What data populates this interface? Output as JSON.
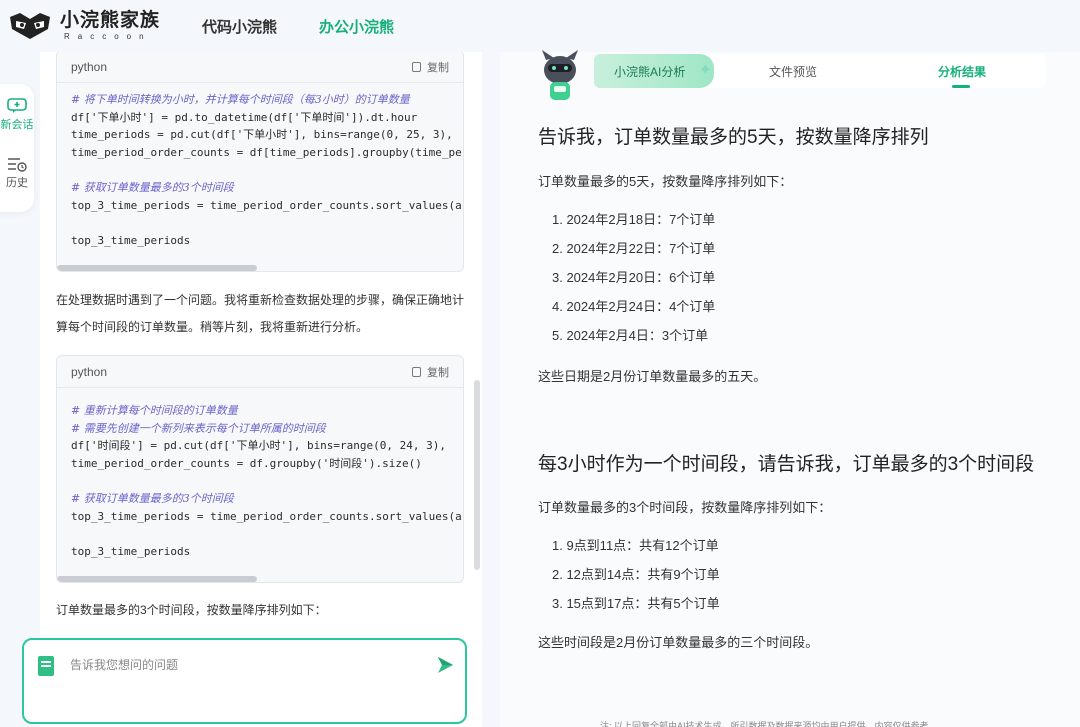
{
  "header": {
    "logo_title": "小浣熊家族",
    "logo_sub": "Raccoon",
    "tabs": [
      {
        "label": "代码小浣熊"
      },
      {
        "label": "办公小浣熊"
      }
    ]
  },
  "siderail": {
    "new_label": "新会话",
    "history_label": "历史"
  },
  "chat": {
    "code_block_1": {
      "lang": "python",
      "copy_label": "复制",
      "lines": [
        "# 将下单时间转换为小时，并计算每个时间段（每3小时）的订单数量",
        "df['下单小时'] = pd.to_datetime(df['下单时间']).dt.hour",
        "time_periods = pd.cut(df['下单小时'], bins=range(0, 25, 3),",
        "time_period_order_counts = df[time_periods].groupby(time_pe",
        "",
        "# 获取订单数量最多的3个时间段",
        "top_3_time_periods = time_period_order_counts.sort_values(a",
        "",
        "top_3_time_periods"
      ]
    },
    "message_1": "在处理数据时遇到了一个问题。我将重新检查数据处理的步骤，确保正确地计算每个时间段的订单数量。稍等片刻，我将重新进行分析。",
    "code_block_2": {
      "lang": "python",
      "copy_label": "复制",
      "lines": [
        "# 重新计算每个时间段的订单数量",
        "# 需要先创建一个新列来表示每个订单所属的时间段",
        "df['时间段'] = pd.cut(df['下单小时'], bins=range(0, 24, 3),",
        "time_period_order_counts = df.groupby('时间段').size()",
        "",
        "# 获取订单数量最多的3个时间段",
        "top_3_time_periods = time_period_order_counts.sort_values(a",
        "",
        "top_3_time_periods"
      ]
    },
    "message_2": "订单数量最多的3个时间段，按数量降序排列如下：",
    "input_placeholder": "告诉我您想问的问题"
  },
  "right": {
    "tab_ai": "小浣熊AI分析",
    "tab_file": "文件预览",
    "tab_result": "分析结果",
    "q1_title": "告诉我，订单数量最多的5天，按数量降序排列",
    "q1_intro": "订单数量最多的5天，按数量降序排列如下：",
    "q1_items": [
      "1. 2024年2月18日：7个订单",
      "2. 2024年2月22日：7个订单",
      "3. 2024年2月20日：6个订单",
      "4. 2024年2月24日：4个订单",
      "5. 2024年2月4日：3个订单"
    ],
    "q1_outro": "这些日期是2月份订单数量最多的五天。",
    "q2_title": "每3小时作为一个时间段，请告诉我，订单最多的3个时间段",
    "q2_intro": "订单数量最多的3个时间段，按数量降序排列如下：",
    "q2_items": [
      "1. 9点到11点：共有12个订单",
      "2. 12点到14点：共有9个订单",
      "3. 15点到17点：共有5个订单"
    ],
    "q2_outro": "这些时间段是2月份订单数量最多的三个时间段。"
  },
  "footer": {
    "note": "注: 以上回复全部由AI技术生成，所引数据及数据来源均由用户提供，内容仅供参考"
  },
  "colors": {
    "accent": "#17b07a",
    "input_border": "#2cc7a0",
    "code_comment": "#6a64c9",
    "code_string": "#c0453e"
  }
}
